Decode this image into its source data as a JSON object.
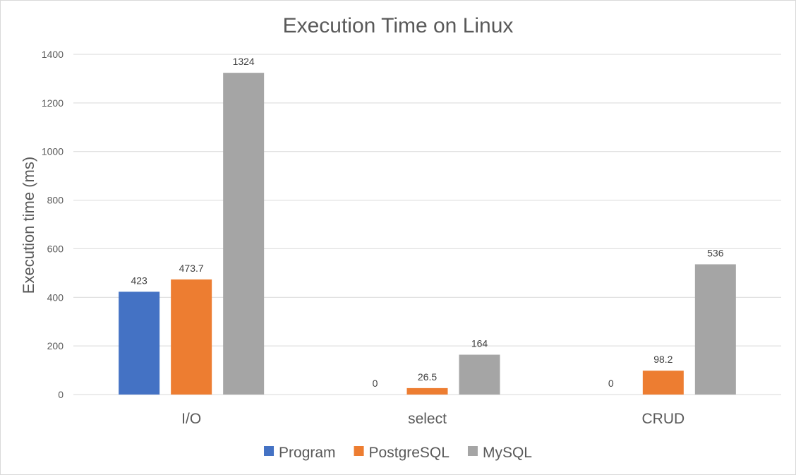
{
  "chart_data": {
    "type": "bar",
    "title": "Execution Time on Linux",
    "xlabel": "",
    "ylabel": "Execution time (ms)",
    "categories": [
      "I/O",
      "select",
      "CRUD"
    ],
    "ylim": [
      0,
      1400
    ],
    "yticks": [
      0,
      200,
      400,
      600,
      800,
      1000,
      1200,
      1400
    ],
    "grid": true,
    "legend_position": "bottom",
    "series": [
      {
        "name": "Program",
        "color": "#4472C4",
        "values": [
          423,
          0,
          0
        ],
        "labels": [
          "423",
          "0",
          "0"
        ]
      },
      {
        "name": "PostgreSQL",
        "color": "#ED7D31",
        "values": [
          473.7,
          26.5,
          98.2
        ],
        "labels": [
          "473.7",
          "26.5",
          "98.2"
        ]
      },
      {
        "name": "MySQL",
        "color": "#A5A5A5",
        "values": [
          1324,
          164,
          536
        ],
        "labels": [
          "1324",
          "164",
          "536"
        ]
      }
    ]
  }
}
